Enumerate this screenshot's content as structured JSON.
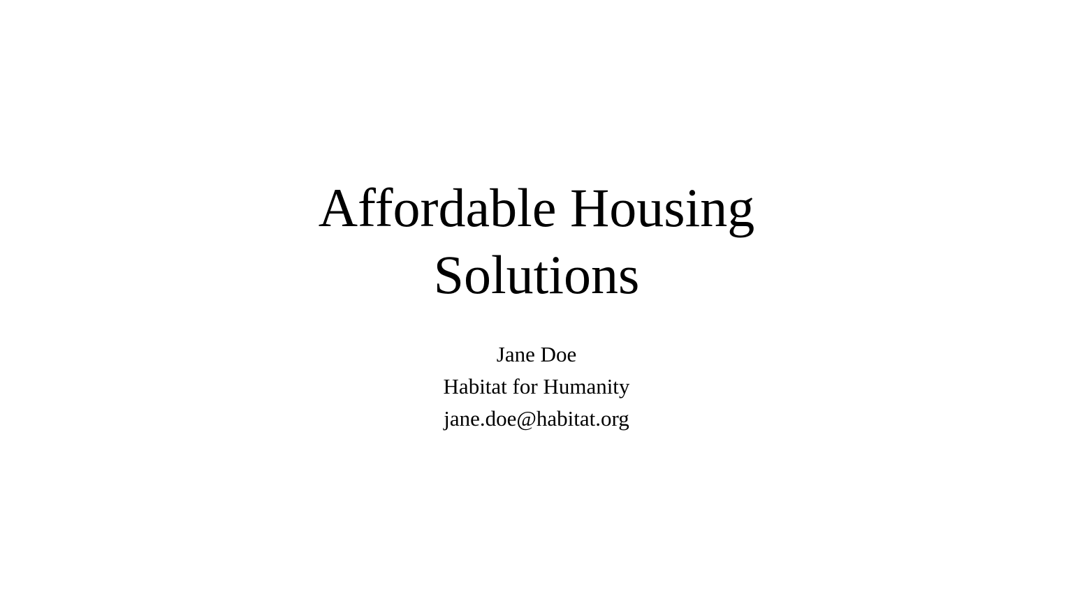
{
  "slide": {
    "title_lines": [
      "Affordable Housing",
      "Solutions"
    ],
    "author": "Jane Doe",
    "organization": "Habitat for Humanity",
    "email": "jane.doe@habitat.org",
    "background_color": "#ffffff",
    "text_color": "#000000"
  }
}
